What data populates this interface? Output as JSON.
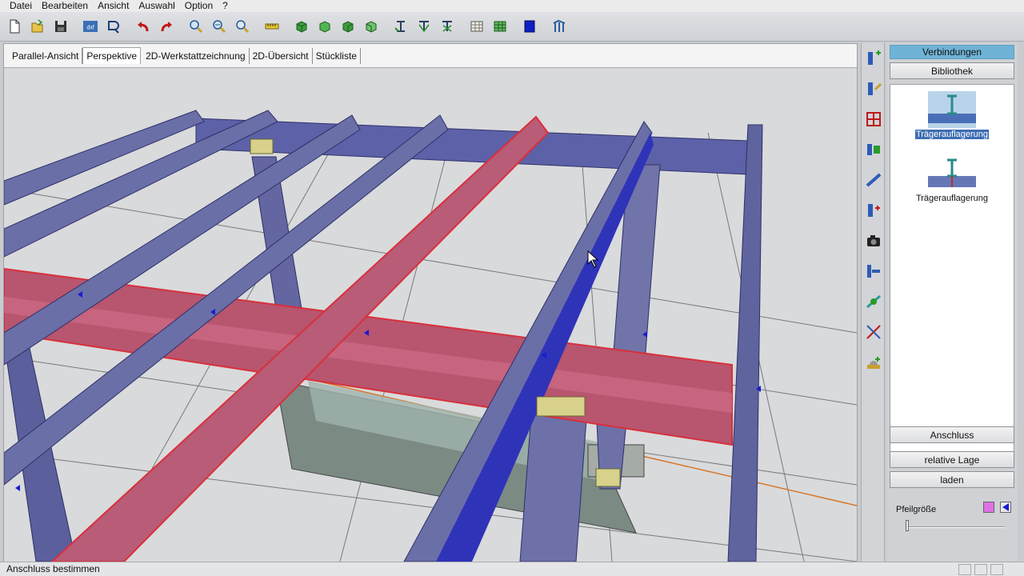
{
  "menu": [
    "Datei",
    "Bearbeiten",
    "Ansicht",
    "Auswahl",
    "Option",
    "?"
  ],
  "toolbar": {
    "icons": [
      "new-file-icon",
      "open-folder-icon",
      "save-disk-icon",
      "dxf-export-icon",
      "plot-icon",
      "undo-icon",
      "redo-icon",
      "zoom-in-icon",
      "zoom-out-icon",
      "zoom-window-icon",
      "measure-icon",
      "cube-view-1-icon",
      "cube-view-2-icon",
      "cube-view-3-icon",
      "cube-view-4-icon",
      "select-1-icon",
      "select-2-icon",
      "select-3-icon",
      "grid-1-icon",
      "grid-2-icon",
      "color-square-icon",
      "structure-icon"
    ],
    "dxf_label": "dxf"
  },
  "tabs": [
    "Parallel-Ansicht",
    "Perspektive",
    "2D-Werkstattzeichnung",
    "2D-Übersicht",
    "Stückliste"
  ],
  "active_tab": 1,
  "vtools": [
    "add-column-icon",
    "edit-column-icon",
    "frame-grid-icon",
    "beam-end-icon",
    "beam-joint-icon",
    "stiffener-icon",
    "camera-icon",
    "plate-icon",
    "bolt-icon",
    "cut-icon",
    "foundation-icon"
  ],
  "panel": {
    "verbindungen": "Verbindungen",
    "bibliothek": "Bibliothek",
    "items": [
      {
        "label": "Trägerauflagerung",
        "selected": true
      },
      {
        "label": "Trägerauflagerung",
        "selected": false
      }
    ],
    "anschluss": "Anschluss",
    "relative_lage": "relative Lage",
    "laden": "laden",
    "pfeilgroesse": "Pfeilgröße",
    "swatch_magenta": "#e070e6",
    "swatch_blue": "#1b1bd0"
  },
  "status": "Anschluss bestimmen",
  "colors": {
    "beam": "#6a6fa8",
    "beam_dark": "#3b3fb0",
    "beam_selected": "#c0587a",
    "highlight_red": "#d8303a",
    "accent": "#6fb3d6"
  }
}
